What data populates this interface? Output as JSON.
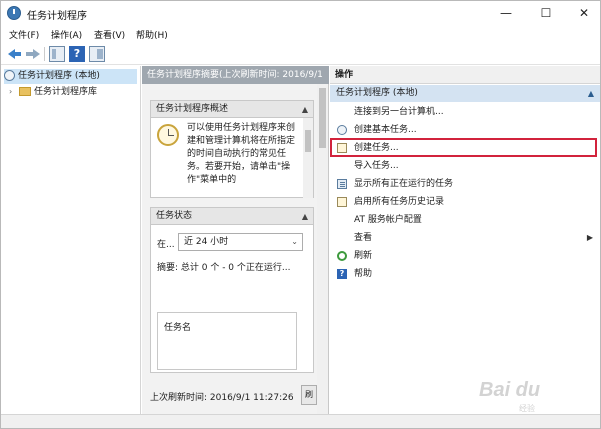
{
  "window": {
    "title": "任务计划程序",
    "minimize_glyph": "—",
    "maximize_glyph": "☐",
    "close_glyph": "✕"
  },
  "menu": [
    {
      "label": "文件(F)"
    },
    {
      "label": "操作(A)"
    },
    {
      "label": "查看(V)"
    },
    {
      "label": "帮助(H)"
    }
  ],
  "toolbar": {
    "help_glyph": "?"
  },
  "tree": {
    "root_label": "任务计划程序 (本地)",
    "child_label": "任务计划程序库",
    "expander_glyph": "›"
  },
  "middle": {
    "header": "任务计划程序摘要(上次刷新时间: 2016/9/1",
    "overview": {
      "title": "任务计划程序概述",
      "collapse_glyph": "▲",
      "text": "可以使用任务计划程序来创建和管理计算机将在所指定的时间自动执行的常见任务。若要开始，请单击\"操作\"菜单中的"
    },
    "status": {
      "title": "任务状态",
      "collapse_glyph": "▲",
      "period_label": "在...",
      "period_value": "近 24 小时",
      "caret_glyph": "⌄",
      "summary": "摘要: 总计 0 个 - 0 个正在运行...",
      "task_name_label": "任务名"
    },
    "footer": {
      "last_refresh": "上次刷新时间: 2016/9/1 11:27:26",
      "refresh_button": "刷"
    }
  },
  "actions": {
    "header": "操作",
    "group_label": "任务计划程序 (本地)",
    "group_collapse_glyph": "▲",
    "items": [
      {
        "label": "连接到另一台计算机...",
        "icon": "none"
      },
      {
        "label": "创建基本任务...",
        "icon": "clock-icon"
      },
      {
        "label": "创建任务...",
        "icon": "task-doc-icon"
      },
      {
        "label": "导入任务...",
        "icon": "none"
      },
      {
        "label": "显示所有正在运行的任务",
        "icon": "list-icon"
      },
      {
        "label": "启用所有任务历史记录",
        "icon": "doc-icon"
      },
      {
        "label": "AT 服务帐户配置",
        "icon": "none"
      },
      {
        "label": "查看",
        "icon": "none",
        "submenu_glyph": "▶"
      },
      {
        "label": "刷新",
        "icon": "refresh-icon"
      },
      {
        "label": "帮助",
        "icon": "help-icon",
        "help_glyph": "?"
      }
    ]
  },
  "watermark": {
    "text": "Bai du",
    "sub": "经验"
  },
  "colors": {
    "highlight": "#d2233c",
    "header_gray": "#9fa7af",
    "actions_group": "#d4e3f2"
  }
}
